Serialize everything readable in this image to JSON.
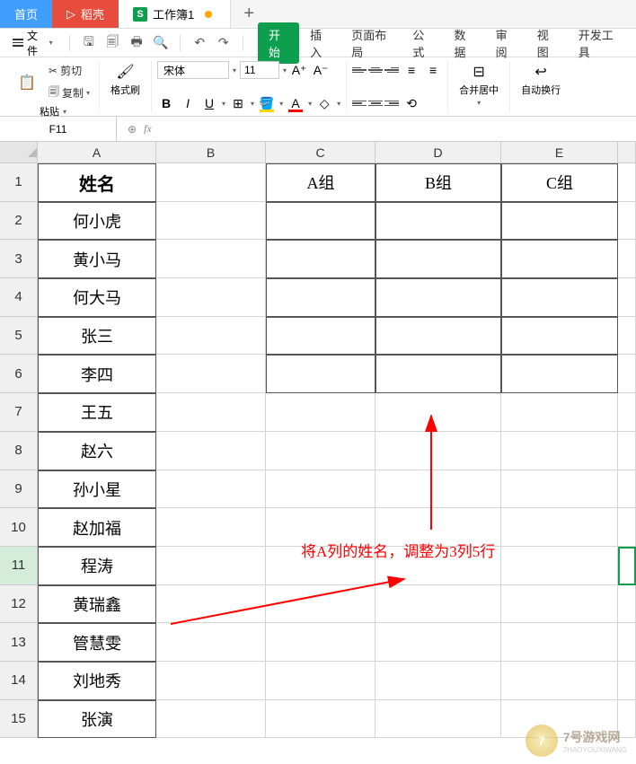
{
  "tabs": {
    "home": "首页",
    "daoke": "稻壳",
    "workbook": "工作簿1"
  },
  "file_menu": "文件",
  "menus": {
    "start": "开始",
    "insert": "插入",
    "layout": "页面布局",
    "formula": "公式",
    "data": "数据",
    "review": "审阅",
    "view": "视图",
    "dev": "开发工具"
  },
  "ribbon": {
    "cut": "剪切",
    "copy": "复制",
    "paste": "粘贴",
    "format_painter": "格式刷",
    "font_name": "宋体",
    "font_size": "11",
    "merge_center": "合并居中",
    "auto_wrap": "自动换行"
  },
  "name_box": "F11",
  "columns": [
    "A",
    "B",
    "C",
    "D",
    "E"
  ],
  "rows": [
    1,
    2,
    3,
    4,
    5,
    6,
    7,
    8,
    9,
    10,
    11,
    12,
    13,
    14,
    15
  ],
  "cells": {
    "A1": "姓名",
    "A2": "何小虎",
    "A3": "黄小马",
    "A4": "何大马",
    "A5": "张三",
    "A6": "李四",
    "A7": "王五",
    "A8": "赵六",
    "A9": "孙小星",
    "A10": "赵加福",
    "A11": "程涛",
    "A12": "黄瑞鑫",
    "A13": "管慧雯",
    "A14": "刘地秀",
    "A15": "张演",
    "C1": "A组",
    "D1": "B组",
    "E1": "C组"
  },
  "annotation": "将A列的姓名，调整为3列5行",
  "watermark": {
    "main": "7号游戏网",
    "sub": "7HAOYOUXIWANG"
  }
}
